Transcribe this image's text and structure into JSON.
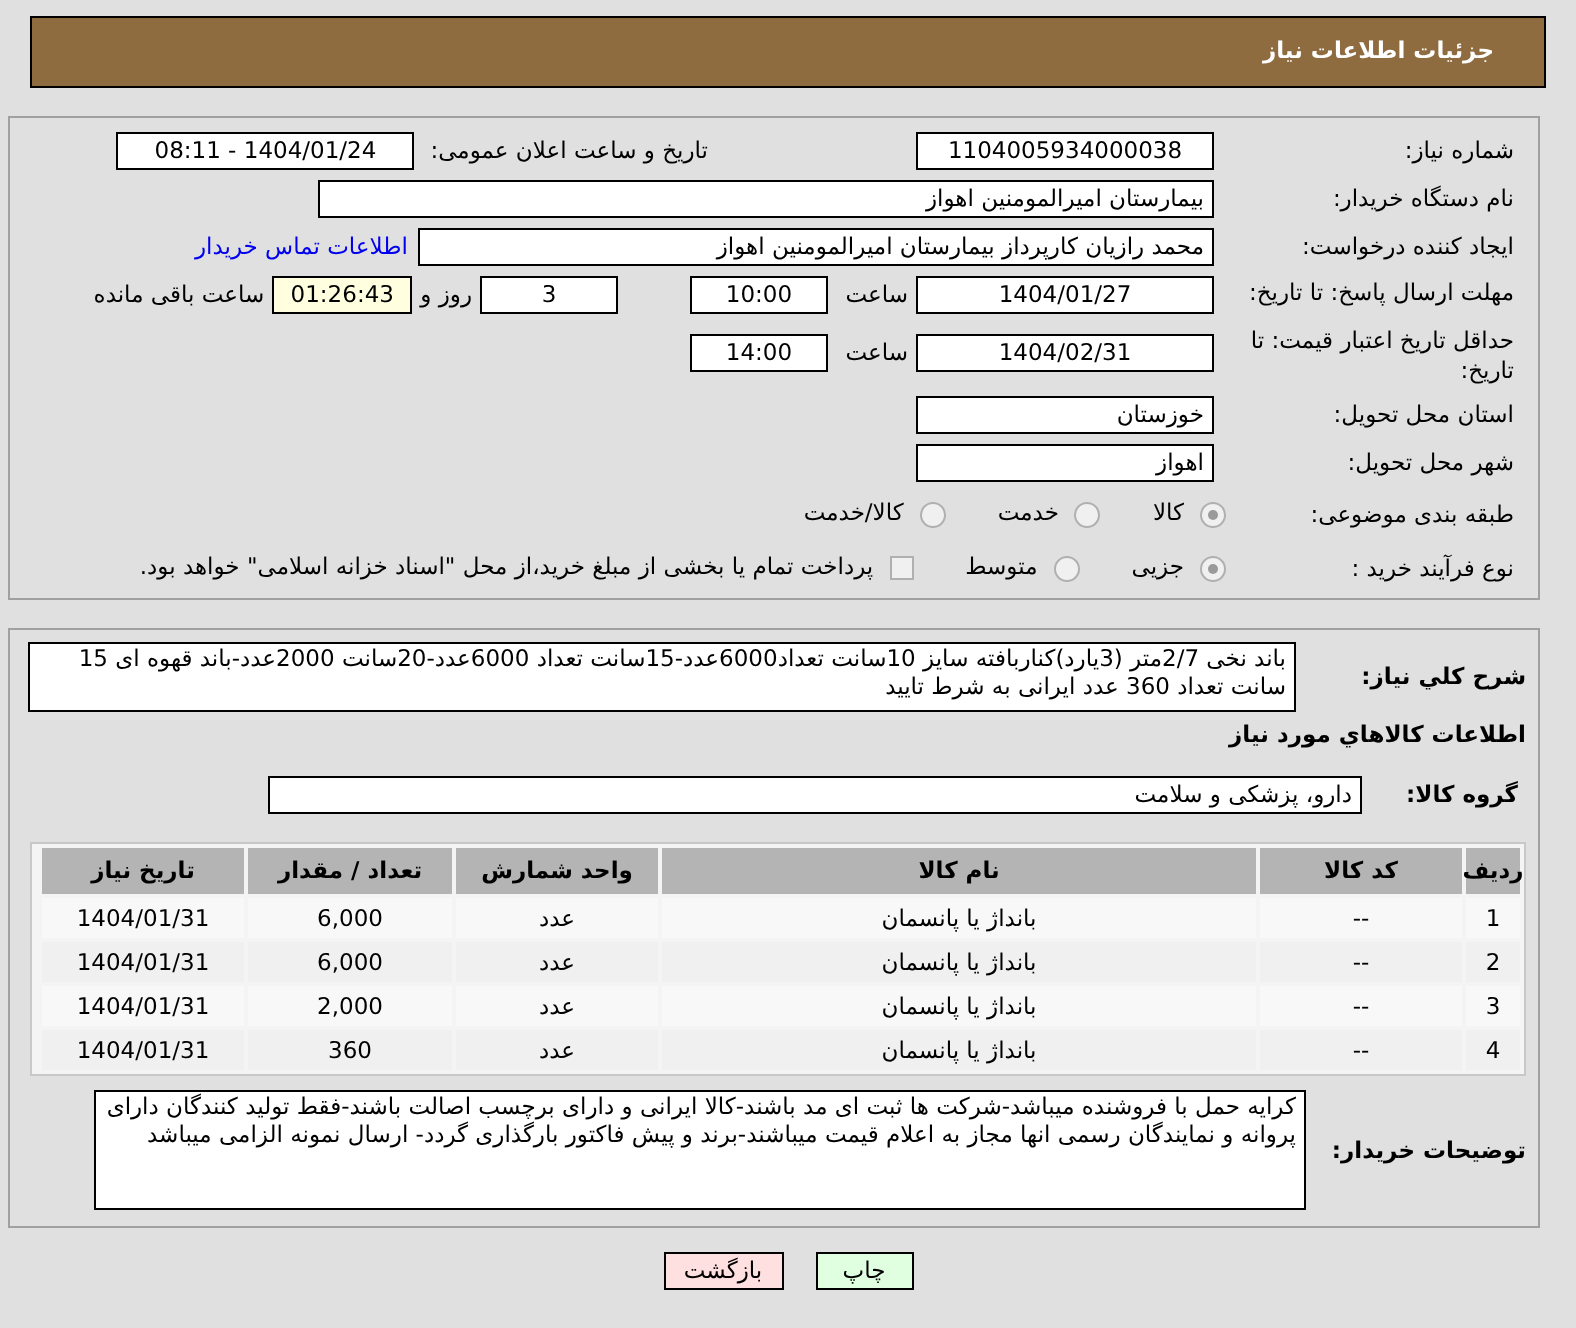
{
  "header": {
    "title": "جزئیات اطلاعات نیاز"
  },
  "info": {
    "need_number": {
      "label": "شماره نیاز:",
      "value": "1104005934000038"
    },
    "announce": {
      "label": "تاریخ و ساعت اعلان عمومی:",
      "value": "1404/01/24 - 08:11"
    },
    "buyer": {
      "label": "نام دستگاه خریدار:",
      "value": "بیمارستان امیرالمومنین اهواز"
    },
    "requester": {
      "label": "ایجاد کننده درخواست:",
      "value": "محمد رازیان کارپرداز بیمارستان امیرالمومنین اهواز",
      "link": "اطلاعات تماس خریدار"
    },
    "deadline": {
      "label": "مهلت ارسال پاسخ: تا تاریخ:",
      "date": "1404/01/27",
      "time_label": "ساعت",
      "time": "10:00",
      "days": "3",
      "days_label": "روز و",
      "remaining": "01:26:43",
      "remaining_label": "ساعت باقی مانده"
    },
    "validity": {
      "label": "حداقل تاریخ اعتبار قیمت: تا تاریخ:",
      "date": "1404/02/31",
      "time_label": "ساعت",
      "time": "14:00"
    },
    "province": {
      "label": "استان محل تحویل:",
      "value": "خوزستان"
    },
    "city": {
      "label": "شهر محل تحویل:",
      "value": "اهواز"
    },
    "category": {
      "label": "طبقه بندی موضوعی:",
      "options": [
        {
          "label": "کالا",
          "selected": true
        },
        {
          "label": "خدمت",
          "selected": false
        },
        {
          "label": "کالا/خدمت",
          "selected": false
        }
      ]
    },
    "process": {
      "label": "نوع فرآیند خرید :",
      "options": [
        {
          "label": "جزیی",
          "selected": true
        },
        {
          "label": "متوسط",
          "selected": false
        }
      ],
      "payment": {
        "checked": false,
        "label": "پرداخت تمام یا بخشی از مبلغ خرید،از محل \"اسناد خزانه اسلامی\" خواهد بود."
      }
    }
  },
  "need": {
    "label": "شرح کلي نياز:",
    "text": "باند نخی 2/7متر (3یارد)کناربافته سایز 10سانت تعداد6000عدد-15سانت تعداد 6000عدد-20سانت 2000عدد-باند قهوه ای 15 سانت تعداد 360 عدد ایرانی به شرط تایید"
  },
  "goods": {
    "title": "اطلاعات کالاهاي مورد نياز",
    "group_label": "گروه کالا:",
    "group": "دارو، پزشکی و سلامت",
    "columns": [
      "ردیف",
      "کد کالا",
      "نام کالا",
      "واحد شمارش",
      "تعداد / مقدار",
      "تاریخ نیاز"
    ],
    "rows": [
      [
        "1",
        "--",
        "بانداژ یا پانسمان",
        "عدد",
        "6,000",
        "1404/01/31"
      ],
      [
        "2",
        "--",
        "بانداژ یا پانسمان",
        "عدد",
        "6,000",
        "1404/01/31"
      ],
      [
        "3",
        "--",
        "بانداژ یا پانسمان",
        "عدد",
        "2,000",
        "1404/01/31"
      ],
      [
        "4",
        "--",
        "بانداژ یا پانسمان",
        "عدد",
        "360",
        "1404/01/31"
      ]
    ]
  },
  "buyer_notes": {
    "label": "توضیحات خریدار:",
    "text": "کرایه حمل با فروشنده میباشد-شرکت ها ثبت ای مد باشند-کالا ایرانی و دارای برچسب اصالت باشند-فقط تولید کنندگان دارای پروانه و نمایندگان رسمی انها مجاز به اعلام قیمت میباشند-برند و پیش فاکتور بارگذاری گردد- ارسال نمونه الزامی میباشد"
  },
  "buttons": [
    {
      "kind": "print",
      "label": "چاپ"
    },
    {
      "kind": "back",
      "label": "بازگشت"
    }
  ]
}
